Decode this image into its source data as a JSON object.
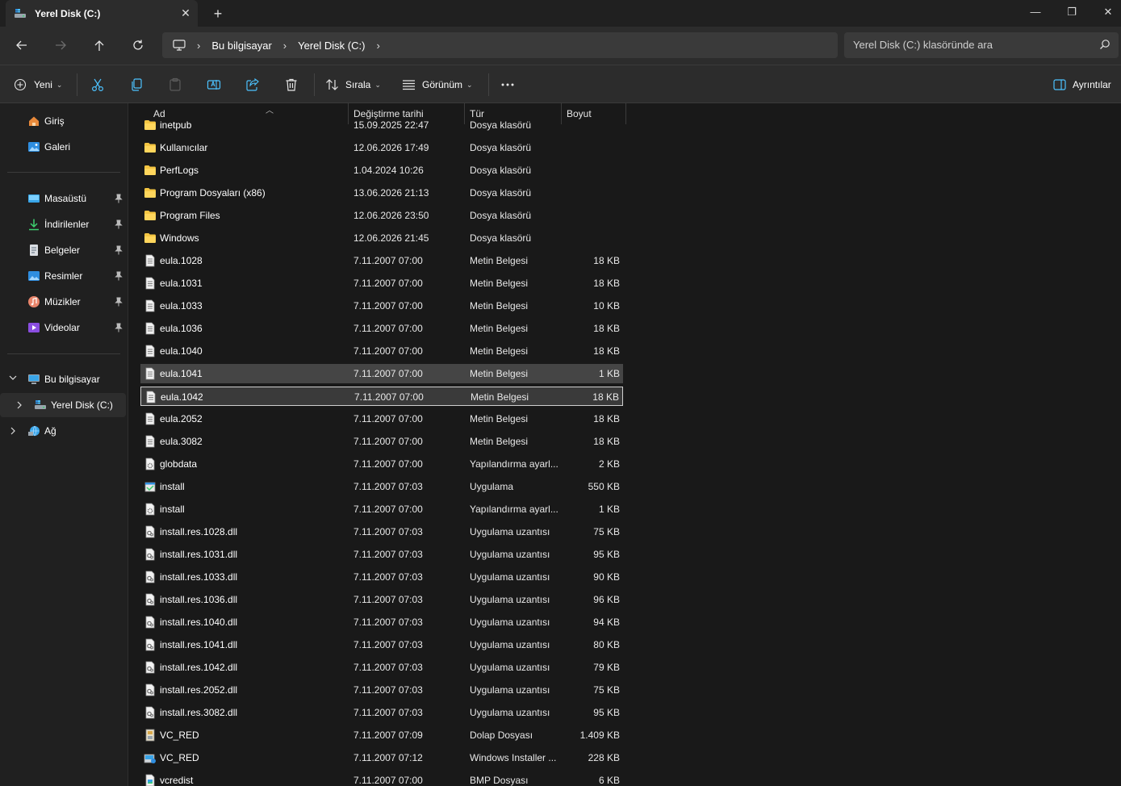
{
  "window": {
    "tab_title": "Yerel Disk (C:)",
    "tab_close": "✕",
    "new_tab": "+",
    "minimize": "—",
    "maximize": "❐",
    "close": "✕"
  },
  "address": {
    "crumbs": [
      "Bu bilgisayar",
      "Yerel Disk (C:)"
    ],
    "search_placeholder": "Yerel Disk (C:) klasöründe ara"
  },
  "toolbar": {
    "new_label": "Yeni",
    "sort_label": "Sırala",
    "view_label": "Görünüm",
    "details_label": "Ayrıntılar"
  },
  "sidebar": {
    "home": "Giriş",
    "gallery": "Galeri",
    "pinned": [
      "Masaüstü",
      "İndirilenler",
      "Belgeler",
      "Resimler",
      "Müzikler",
      "Videolar"
    ],
    "this_pc": "Bu bilgisayar",
    "local_disk": "Yerel Disk (C:)",
    "network": "Ağ"
  },
  "columns": {
    "name": "Ad",
    "date": "Değiştirme tarihi",
    "type": "Tür",
    "size": "Boyut"
  },
  "files": [
    {
      "name": "inetpub",
      "date": "15.09.2025 22:47",
      "type": "Dosya klasörü",
      "size": "",
      "icon": "folder"
    },
    {
      "name": "Kullanıcılar",
      "date": "12.06.2026 17:49",
      "type": "Dosya klasörü",
      "size": "",
      "icon": "folder"
    },
    {
      "name": "PerfLogs",
      "date": "1.04.2024 10:26",
      "type": "Dosya klasörü",
      "size": "",
      "icon": "folder"
    },
    {
      "name": "Program Dosyaları (x86)",
      "date": "13.06.2026 21:13",
      "type": "Dosya klasörü",
      "size": "",
      "icon": "folder"
    },
    {
      "name": "Program Files",
      "date": "12.06.2026 23:50",
      "type": "Dosya klasörü",
      "size": "",
      "icon": "folder"
    },
    {
      "name": "Windows",
      "date": "12.06.2026 21:45",
      "type": "Dosya klasörü",
      "size": "",
      "icon": "folder"
    },
    {
      "name": "eula.1028",
      "date": "7.11.2007 07:00",
      "type": "Metin Belgesi",
      "size": "18 KB",
      "icon": "text"
    },
    {
      "name": "eula.1031",
      "date": "7.11.2007 07:00",
      "type": "Metin Belgesi",
      "size": "18 KB",
      "icon": "text"
    },
    {
      "name": "eula.1033",
      "date": "7.11.2007 07:00",
      "type": "Metin Belgesi",
      "size": "10 KB",
      "icon": "text"
    },
    {
      "name": "eula.1036",
      "date": "7.11.2007 07:00",
      "type": "Metin Belgesi",
      "size": "18 KB",
      "icon": "text"
    },
    {
      "name": "eula.1040",
      "date": "7.11.2007 07:00",
      "type": "Metin Belgesi",
      "size": "18 KB",
      "icon": "text"
    },
    {
      "name": "eula.1041",
      "date": "7.11.2007 07:00",
      "type": "Metin Belgesi",
      "size": "1 KB",
      "icon": "text"
    },
    {
      "name": "eula.1042",
      "date": "7.11.2007 07:00",
      "type": "Metin Belgesi",
      "size": "18 KB",
      "icon": "text"
    },
    {
      "name": "eula.2052",
      "date": "7.11.2007 07:00",
      "type": "Metin Belgesi",
      "size": "18 KB",
      "icon": "text"
    },
    {
      "name": "eula.3082",
      "date": "7.11.2007 07:00",
      "type": "Metin Belgesi",
      "size": "18 KB",
      "icon": "text"
    },
    {
      "name": "globdata",
      "date": "7.11.2007 07:00",
      "type": "Yapılandırma ayarl...",
      "size": "2 KB",
      "icon": "config"
    },
    {
      "name": "install",
      "date": "7.11.2007 07:03",
      "type": "Uygulama",
      "size": "550 KB",
      "icon": "app"
    },
    {
      "name": "install",
      "date": "7.11.2007 07:00",
      "type": "Yapılandırma ayarl...",
      "size": "1 KB",
      "icon": "config"
    },
    {
      "name": "install.res.1028.dll",
      "date": "7.11.2007 07:03",
      "type": "Uygulama uzantısı",
      "size": "75 KB",
      "icon": "dll"
    },
    {
      "name": "install.res.1031.dll",
      "date": "7.11.2007 07:03",
      "type": "Uygulama uzantısı",
      "size": "95 KB",
      "icon": "dll"
    },
    {
      "name": "install.res.1033.dll",
      "date": "7.11.2007 07:03",
      "type": "Uygulama uzantısı",
      "size": "90 KB",
      "icon": "dll"
    },
    {
      "name": "install.res.1036.dll",
      "date": "7.11.2007 07:03",
      "type": "Uygulama uzantısı",
      "size": "96 KB",
      "icon": "dll"
    },
    {
      "name": "install.res.1040.dll",
      "date": "7.11.2007 07:03",
      "type": "Uygulama uzantısı",
      "size": "94 KB",
      "icon": "dll"
    },
    {
      "name": "install.res.1041.dll",
      "date": "7.11.2007 07:03",
      "type": "Uygulama uzantısı",
      "size": "80 KB",
      "icon": "dll"
    },
    {
      "name": "install.res.1042.dll",
      "date": "7.11.2007 07:03",
      "type": "Uygulama uzantısı",
      "size": "79 KB",
      "icon": "dll"
    },
    {
      "name": "install.res.2052.dll",
      "date": "7.11.2007 07:03",
      "type": "Uygulama uzantısı",
      "size": "75 KB",
      "icon": "dll"
    },
    {
      "name": "install.res.3082.dll",
      "date": "7.11.2007 07:03",
      "type": "Uygulama uzantısı",
      "size": "95 KB",
      "icon": "dll"
    },
    {
      "name": "VC_RED",
      "date": "7.11.2007 07:09",
      "type": "Dolap Dosyası",
      "size": "1.409 KB",
      "icon": "cab"
    },
    {
      "name": "VC_RED",
      "date": "7.11.2007 07:12",
      "type": "Windows Installer ...",
      "size": "228 KB",
      "icon": "msi"
    },
    {
      "name": "vcredist",
      "date": "7.11.2007 07:00",
      "type": "BMP Dosyası",
      "size": "6 KB",
      "icon": "bmp"
    }
  ],
  "selection": {
    "hover_row": "eula.1041",
    "focused_row": "eula.1042"
  },
  "colors": {
    "accent": "#4cc2ff",
    "folder": "#f4c542",
    "background": "#191919"
  }
}
